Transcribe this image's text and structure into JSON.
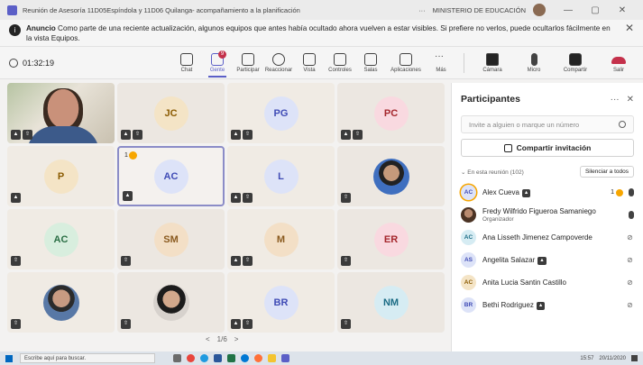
{
  "window": {
    "title": "Reunión de Asesoría 11D05Espíndola y 11D06 Quilanga- acompañamiento a la planificación",
    "more": "···",
    "org": "MINISTERIO DE EDUCACIÓN",
    "minimize": "—",
    "restore": "▢",
    "close": "✕"
  },
  "banner": {
    "title": "Anuncio",
    "message": "Como parte de una reciente actualización, algunos equipos que antes había ocultado ahora vuelven a estar visibles. Si prefiere no verlos, puede ocultarlos fácilmente en la vista Equipos.",
    "close": "✕"
  },
  "toolbar": {
    "timer": "01:32:19",
    "chat": "Chat",
    "people": "Gente",
    "people_badge": "9",
    "participate": "Participar",
    "react": "Reaccionar",
    "view": "Vista",
    "controls": "Controles",
    "rooms": "Salas",
    "apps": "Aplicaciones",
    "more": "Más",
    "camera": "Cámara",
    "mic": "Micro",
    "share": "Compartir",
    "leave": "Salir"
  },
  "tiles": [
    {
      "type": "video",
      "chips": [
        "▲",
        "⇧"
      ]
    },
    {
      "type": "initials",
      "text": "JC",
      "color": "c1",
      "chips": [
        "▲",
        "⇧"
      ]
    },
    {
      "type": "initials",
      "text": "PG",
      "color": "c2",
      "chips": [
        "▲",
        "⇧"
      ]
    },
    {
      "type": "initials",
      "text": "PC",
      "color": "c3",
      "chips": [
        "▲",
        "⇧"
      ]
    },
    {
      "type": "initials",
      "text": "P",
      "color": "c1",
      "chips": [
        "▲"
      ]
    },
    {
      "type": "initials",
      "text": "AC",
      "color": "c2",
      "chips": [
        "▲"
      ],
      "selected": true,
      "hand": "1"
    },
    {
      "type": "initials",
      "text": "L",
      "color": "c2",
      "chips": [
        "▲",
        "⇧"
      ]
    },
    {
      "type": "photo",
      "variant": "p3",
      "chips": [
        "⇧"
      ]
    },
    {
      "type": "initials",
      "text": "AC",
      "color": "c5",
      "chips": [
        "⇧"
      ]
    },
    {
      "type": "initials",
      "text": "SM",
      "color": "c4",
      "chips": [
        "⇧"
      ]
    },
    {
      "type": "initials",
      "text": "M",
      "color": "c4",
      "chips": [
        "▲",
        "⇧"
      ]
    },
    {
      "type": "initials",
      "text": "ER",
      "color": "c3",
      "chips": [
        "⇧"
      ]
    },
    {
      "type": "photo",
      "variant": "p1",
      "chips": [
        "⇧"
      ]
    },
    {
      "type": "photo",
      "variant": "p2",
      "chips": [
        "⇧"
      ]
    },
    {
      "type": "initials",
      "text": "BR",
      "color": "c2",
      "chips": [
        "▲",
        "⇧"
      ]
    },
    {
      "type": "initials",
      "text": "NM",
      "color": "c6",
      "chips": [
        "⇧"
      ]
    }
  ],
  "pager": {
    "prev": "<",
    "page": "1/6",
    "next": ">"
  },
  "panel": {
    "title": "Participantes",
    "more": "···",
    "close": "✕",
    "invite_placeholder": "Invite a alguien o marque un número",
    "share_invite": "Compartir invitación",
    "section": "En esta reunión (102)",
    "mute_all": "Silenciar a todos",
    "people": [
      {
        "initials": "AC",
        "name": "Alex Cueva",
        "tag": "▲",
        "hand": "1",
        "mic": "on",
        "color": "c2",
        "ring": true
      },
      {
        "initials": "",
        "name": "Fredy Wilfrido Figueroa Samaniego",
        "sub": "Organizador",
        "mic": "on",
        "photo": true
      },
      {
        "initials": "AC",
        "name": "Ana Lisseth Jimenez Campoverde",
        "mic": "off",
        "color": "c6"
      },
      {
        "initials": "AS",
        "name": "Angelita Salazar",
        "tag": "▲",
        "mic": "off",
        "color": "c2"
      },
      {
        "initials": "AC",
        "name": "Anita Lucia Santin Castillo",
        "mic": "off",
        "color": "c1"
      },
      {
        "initials": "BR",
        "name": "Bethi Rodriguez",
        "tag": "▲",
        "mic": "off",
        "color": "c2"
      }
    ]
  },
  "taskbar": {
    "search_placeholder": "Escribe aquí para buscar.",
    "time": "15:57",
    "date": "20/11/2020"
  }
}
